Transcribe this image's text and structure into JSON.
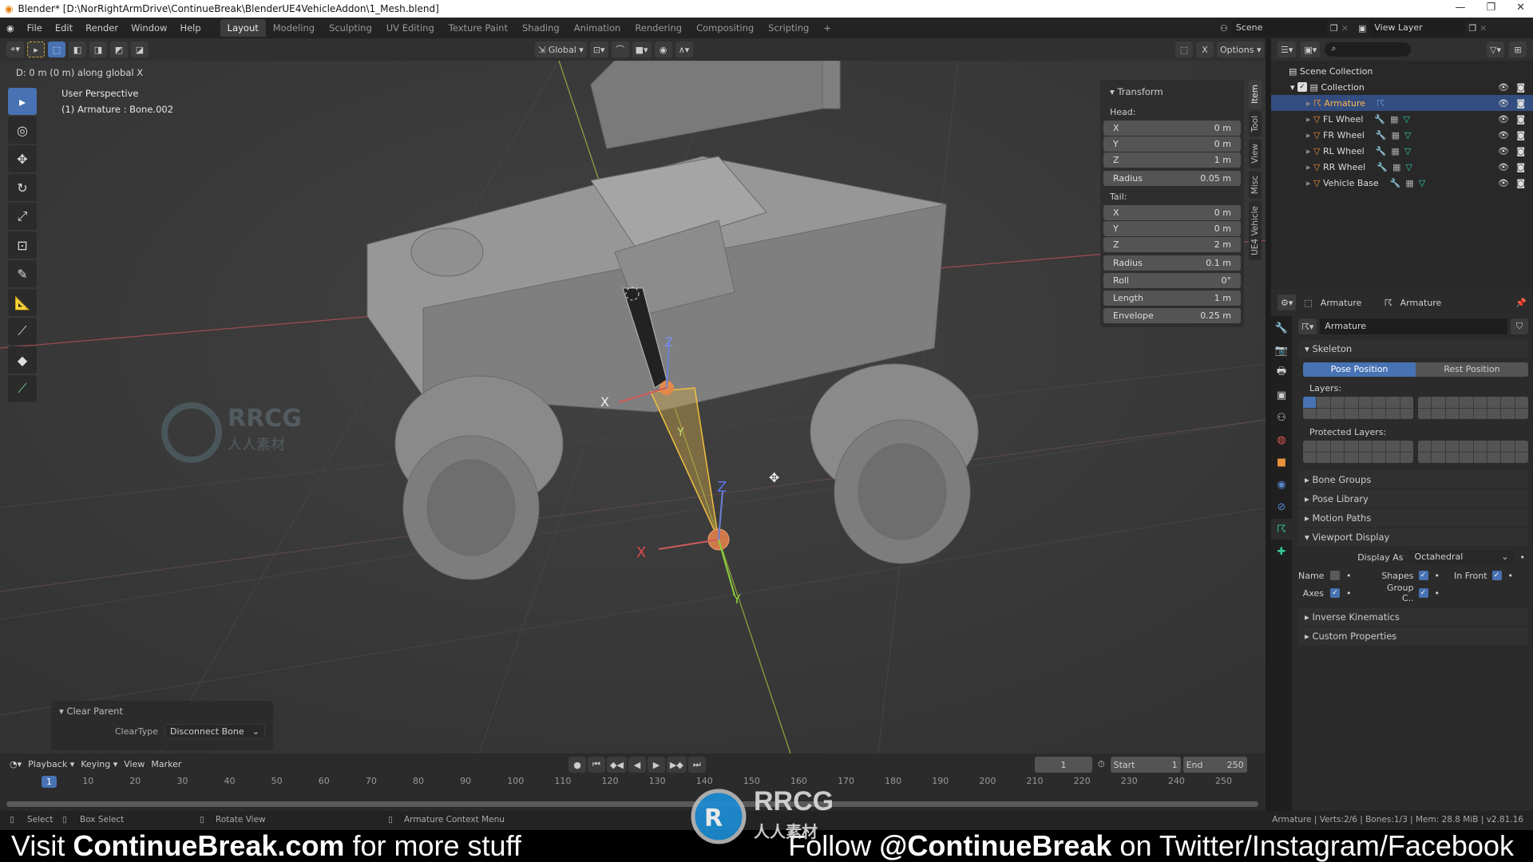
{
  "window": {
    "title": "Blender* [D:\\NorRightArmDrive\\ContinueBreak\\BlenderUE4VehicleAddon\\1_Mesh.blend]",
    "controls": [
      "—",
      "❐",
      "✕"
    ]
  },
  "menu": {
    "items": [
      "File",
      "Edit",
      "Render",
      "Window",
      "Help"
    ],
    "workspaces": [
      "Layout",
      "Modeling",
      "Sculpting",
      "UV Editing",
      "Texture Paint",
      "Shading",
      "Animation",
      "Rendering",
      "Compositing",
      "Scripting"
    ],
    "active_workspace": "Layout",
    "add": "+",
    "scene": "Scene",
    "view_layer": "View Layer"
  },
  "viewport": {
    "orientation": "Global",
    "options": "Options",
    "x_label": "X",
    "status_text": "D: 0 m (0 m) along global X",
    "view_name": "User Perspective",
    "active": "(1) Armature : Bone.002",
    "axis_labels": {
      "x": "X",
      "y": "Y",
      "z": "Z"
    }
  },
  "transform": {
    "title": "Transform",
    "head_label": "Head:",
    "tail_label": "Tail:",
    "head": [
      {
        "label": "X",
        "value": "0 m"
      },
      {
        "label": "Y",
        "value": "0 m"
      },
      {
        "label": "Z",
        "value": "1 m"
      }
    ],
    "head_radius": {
      "label": "Radius",
      "value": "0.05 m"
    },
    "tail": [
      {
        "label": "X",
        "value": "0 m"
      },
      {
        "label": "Y",
        "value": "0 m"
      },
      {
        "label": "Z",
        "value": "2 m"
      }
    ],
    "tail_radius": {
      "label": "Radius",
      "value": "0.1 m"
    },
    "roll": {
      "label": "Roll",
      "value": "0°"
    },
    "length": {
      "label": "Length",
      "value": "1 m"
    },
    "envelope": {
      "label": "Envelope",
      "value": "0.25 m"
    }
  },
  "ntabs": [
    "Item",
    "Tool",
    "View",
    "Misc",
    "UE4 Vehicle"
  ],
  "clear_parent": {
    "title": "Clear Parent",
    "label": "ClearType",
    "value": "Disconnect Bone"
  },
  "outliner": {
    "scene_collection": "Scene Collection",
    "collection": "Collection",
    "items": [
      "Armature",
      "FL Wheel",
      "FR Wheel",
      "RL Wheel",
      "RR Wheel",
      "Vehicle Base"
    ],
    "selected": "Armature"
  },
  "properties": {
    "object": "Armature",
    "data": "Armature",
    "datablock": "Armature",
    "skeleton": "Skeleton",
    "pose_position": "Pose Position",
    "rest_position": "Rest Position",
    "layers": "Layers:",
    "protected_layers": "Protected Layers:",
    "panels_closed": [
      "Bone Groups",
      "Pose Library",
      "Motion Paths"
    ],
    "viewport_display": "Viewport Display",
    "display_as_label": "Display As",
    "display_as": "Octahedral",
    "name": "Name",
    "shapes": "Shapes",
    "in_front": "In Front",
    "axes": "Axes",
    "group_colors": "Group C..",
    "checks": {
      "name": false,
      "shapes": true,
      "in_front": true,
      "axes": true,
      "group_colors": true
    },
    "panels_after": [
      "Inverse Kinematics",
      "Custom Properties"
    ]
  },
  "timeline": {
    "menus": [
      "Playback",
      "Keying",
      "View",
      "Marker"
    ],
    "current_frame": "1",
    "start_label": "Start",
    "start": "1",
    "end_label": "End",
    "end": "250",
    "ticks": [
      "1",
      "10",
      "20",
      "30",
      "40",
      "50",
      "60",
      "70",
      "80",
      "90",
      "100",
      "110",
      "120",
      "130",
      "140",
      "150",
      "160",
      "170",
      "180",
      "190",
      "200",
      "210",
      "220",
      "230",
      "240",
      "250"
    ]
  },
  "status": {
    "select": "Select",
    "box_select": "Box Select",
    "rotate": "Rotate View",
    "context": "Armature Context Menu",
    "stats": "Armature | Verts:2/6 | Bones:1/3 | Mem: 28.8 MiB | v2.81.16"
  },
  "caption": {
    "left_pre": "Visit ",
    "left_bold": "ContinueBreak.com",
    "left_post": " for more stuff",
    "right_pre": "Follow ",
    "right_bold": "@ContinueBreak",
    "right_post": " on Twitter/Instagram/Facebook"
  },
  "watermark": "RRCG 人人素材",
  "colors": {
    "accent": "#4772b3",
    "selected_row": "#334d80",
    "bone_active": "#e8a23a",
    "axis_x": "#e04848",
    "axis_y": "#8ccf3c",
    "axis_z": "#5a74e6"
  }
}
